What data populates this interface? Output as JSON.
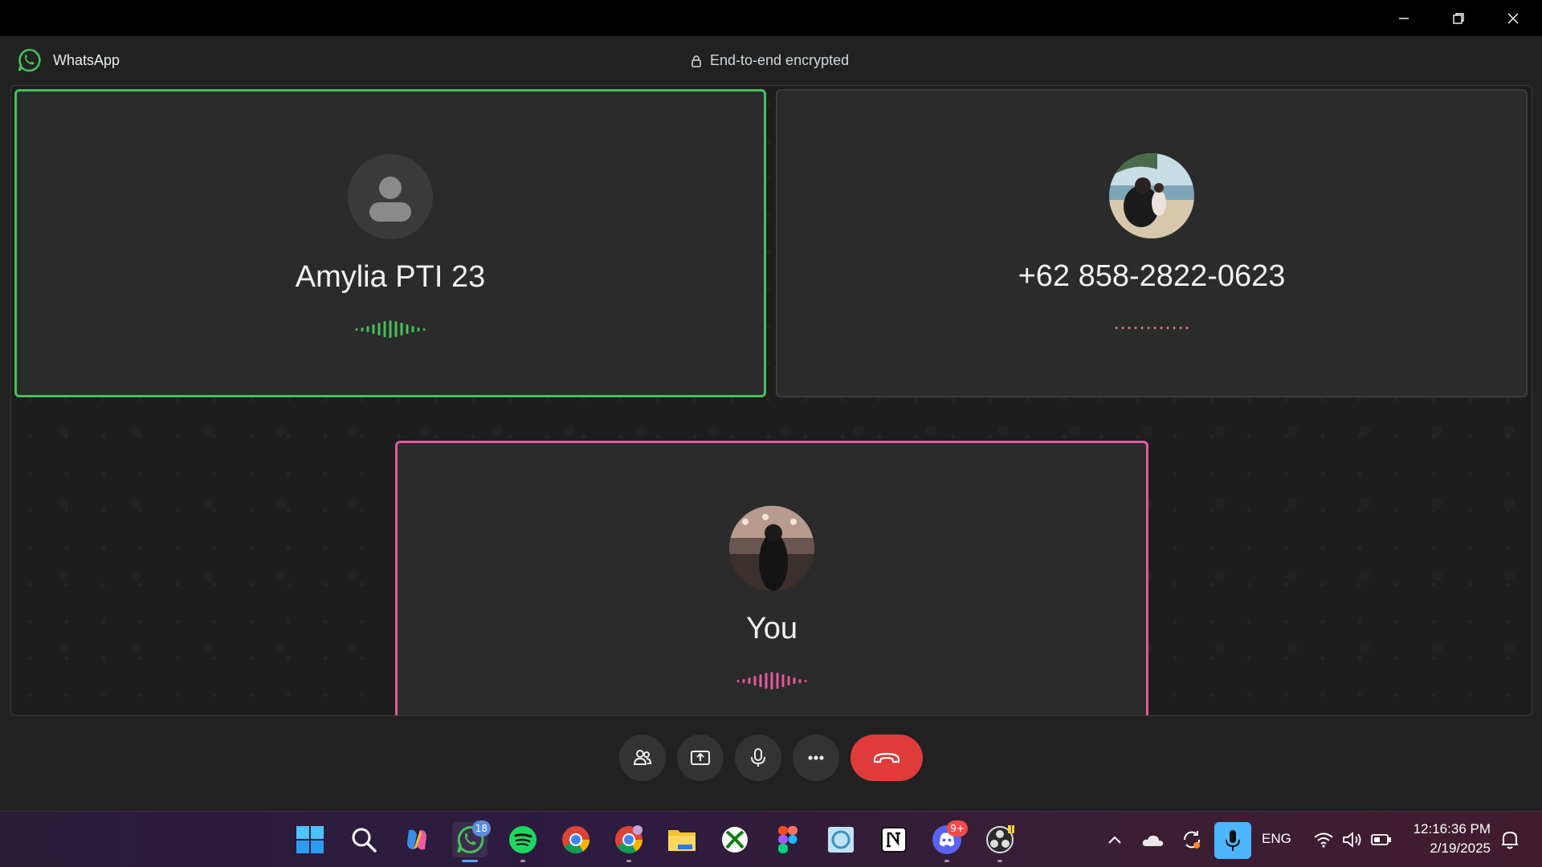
{
  "window": {
    "minimize_label": "",
    "restore_label": "",
    "close_label": ""
  },
  "app": {
    "name": "WhatsApp",
    "encryption_note": "End-to-end encrypted",
    "accent": "#45c05a"
  },
  "participants": [
    {
      "name": "Amylia PTI 23",
      "avatar": "default-user-icon",
      "status": "speaking",
      "color": "#45c05a"
    },
    {
      "name": "+62 858-2822-0623",
      "avatar": "photo-beach",
      "status": "connecting",
      "color": "#e08560"
    },
    {
      "name": "You",
      "avatar": "photo-self",
      "status": "speaking",
      "color": "#e5589d"
    }
  ],
  "controls": {
    "participants_icon": "people-icon",
    "share_icon": "screen-share-icon",
    "mic_icon": "microphone-icon",
    "more_icon": "more-icon",
    "end_icon": "hang-up-icon",
    "end_color": "#e03b3b"
  },
  "taskbar": {
    "apps": [
      {
        "name": "windows-start"
      },
      {
        "name": "search"
      },
      {
        "name": "copilot"
      },
      {
        "name": "whatsapp",
        "badge": "18",
        "active": true
      },
      {
        "name": "spotify"
      },
      {
        "name": "chrome"
      },
      {
        "name": "chrome-profile"
      },
      {
        "name": "file-explorer"
      },
      {
        "name": "xbox"
      },
      {
        "name": "figma"
      },
      {
        "name": "photo-app"
      },
      {
        "name": "notion"
      },
      {
        "name": "discord",
        "badge": "9+"
      },
      {
        "name": "obs"
      }
    ],
    "tray": {
      "language": "ENG",
      "time": "12:16:36 PM",
      "date": "2/19/2025"
    }
  }
}
